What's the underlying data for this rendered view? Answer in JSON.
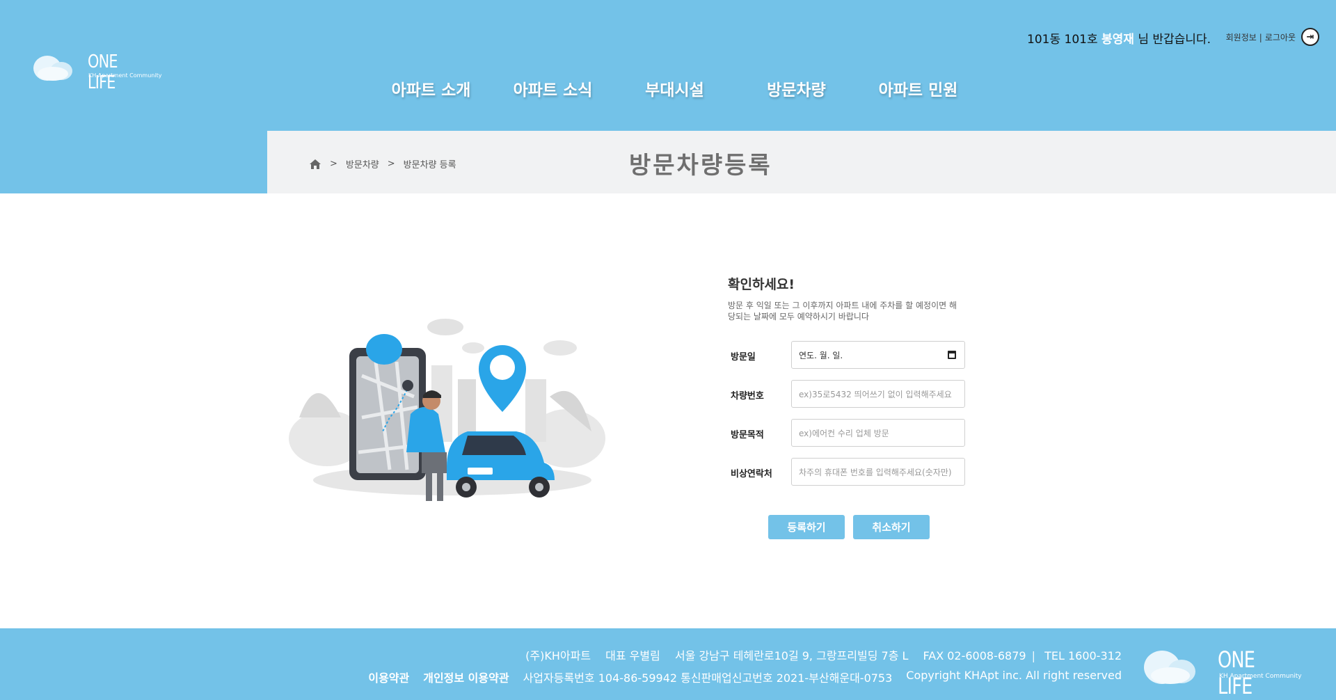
{
  "brand": {
    "name": "ONE LIFE",
    "tagline": "KH Apartment Community"
  },
  "header": {
    "greeting_prefix": "101동 101호 ",
    "user_name": "봉영재",
    "greeting_suffix": " 님 반갑습니다.",
    "member_info": "회원정보",
    "logout": "로그아웃",
    "nav": [
      "아파트 소개",
      "아파트 소식",
      "부대시설",
      "방문차량",
      "아파트 민원"
    ]
  },
  "breadcrumb": {
    "home_icon": "home-icon",
    "sep": ">",
    "level1": "방문차량",
    "level2": "방문차량 등록"
  },
  "page_title": "방문차량등록",
  "form": {
    "heading": "확인하세요!",
    "notice": "방문 후 익일 또는 그 이후까지 아파트 내에 주차를 할 예정이면 해당되는 날짜에 모두 예약하시기 바랍니다",
    "fields": {
      "visit_date": {
        "label": "방문일",
        "value": "연도. 월. 일."
      },
      "car_number": {
        "label": "차량번호",
        "placeholder": "ex)35로5432 띄어쓰기 없이 입력해주세요"
      },
      "purpose": {
        "label": "방문목적",
        "placeholder": "ex)에어컨 수리 업체 방문"
      },
      "contact": {
        "label": "비상연락처",
        "placeholder": "차주의 휴대폰 번호를 입력해주세요(숫자만)"
      }
    },
    "submit": "등록하기",
    "cancel": "취소하기"
  },
  "footer": {
    "company": "(주)KH아파트",
    "ceo": "대표 우별림",
    "address": "서울 강남구 테헤란로10길 9, 그랑프리빌딩 7층 L",
    "fax": "FAX 02-6008-6879",
    "tel": "TEL 1600-312",
    "terms": "이용약관",
    "privacy": "개인정보 이용약관",
    "biz_no": "사업자등록번호 104-86-59942 통신판매업신고번호 2021-부산해운대-0753",
    "copyright": "Copyright KHApt inc. All right reserved"
  },
  "colors": {
    "primary": "#73c2e8",
    "band": "#f1f2f3",
    "title_gray": "#6f6f6f",
    "illustration_blue": "#2aa5e8"
  }
}
